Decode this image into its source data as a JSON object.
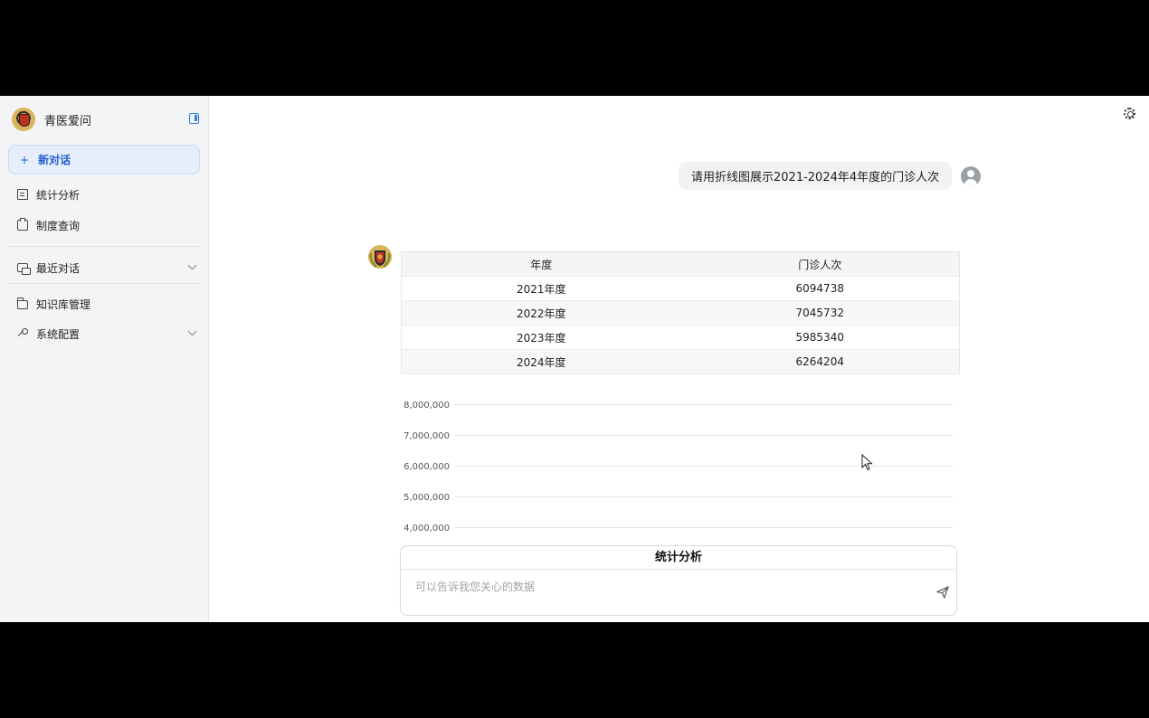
{
  "sidebar": {
    "brand": "青医爱问",
    "new_chat": "新对话",
    "new_chat_plus": "+",
    "items": [
      {
        "label": "统计分析"
      },
      {
        "label": "制度查询"
      },
      {
        "label": "最近对话"
      },
      {
        "label": "知识库管理"
      },
      {
        "label": "系统配置"
      }
    ]
  },
  "chat": {
    "user_message": "请用折线图展示2021-2024年4年度的门诊人次",
    "table": {
      "headers": [
        "年度",
        "门诊人次"
      ],
      "rows": [
        [
          "2021年度",
          "6094738"
        ],
        [
          "2022年度",
          "7045732"
        ],
        [
          "2023年度",
          "5985340"
        ],
        [
          "2024年度",
          "6264204"
        ]
      ]
    }
  },
  "chart_data": {
    "type": "line",
    "y_ticks": [
      "8,000,000",
      "7,000,000",
      "6,000,000",
      "5,000,000",
      "4,000,000"
    ],
    "ylim": [
      4000000,
      8000000
    ],
    "grid": true
  },
  "composer": {
    "title": "统计分析",
    "placeholder": "可以告诉我您关心的数据"
  },
  "colors": {
    "accent": "#1f5fd1",
    "sidebar_bg": "#f3f4f6"
  }
}
